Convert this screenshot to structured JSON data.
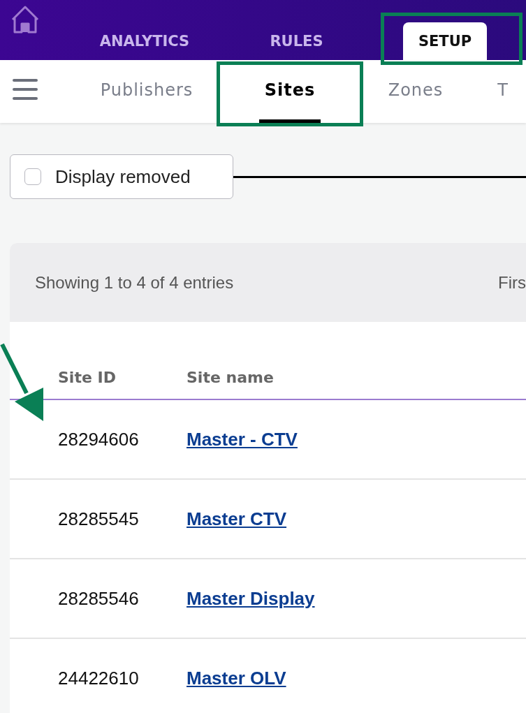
{
  "main_tabs": [
    {
      "label": "ANALYTICS",
      "selected": false,
      "highlighted": false
    },
    {
      "label": "RULES",
      "selected": false,
      "highlighted": false
    },
    {
      "label": "SETUP",
      "selected": true,
      "highlighted": true
    }
  ],
  "sub_tabs": [
    {
      "label": "Publishers",
      "selected": false,
      "highlighted": false
    },
    {
      "label": "Sites",
      "selected": true,
      "highlighted": true
    },
    {
      "label": "Zones",
      "selected": false,
      "highlighted": false
    },
    {
      "label": "T",
      "selected": false,
      "highlighted": false
    }
  ],
  "filter": {
    "label": "Display removed",
    "checked": false
  },
  "annotations": {
    "pointer_line": true,
    "row_arrow": true
  },
  "table": {
    "summary": "Showing 1 to 4 of 4 entries",
    "pager": "Firs",
    "columns": [
      "Site ID",
      "Site name"
    ],
    "rows": [
      {
        "site_id": "28294606",
        "site_name": "Master - CTV"
      },
      {
        "site_id": "28285545",
        "site_name": "Master CTV"
      },
      {
        "site_id": "28285546",
        "site_name": "Master Display"
      },
      {
        "site_id": "24422610",
        "site_name": "Master OLV"
      }
    ]
  }
}
